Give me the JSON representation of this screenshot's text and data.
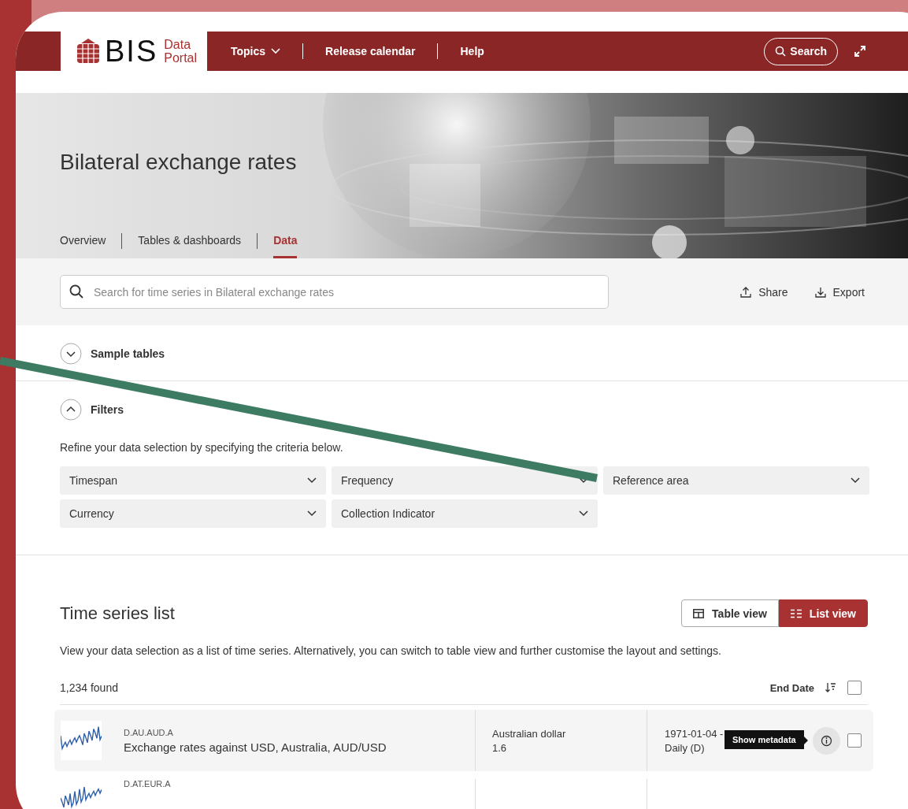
{
  "header": {
    "logo": {
      "mark": "BIS",
      "line1": "Data",
      "line2": "Portal"
    },
    "nav": [
      {
        "label": "Topics",
        "dropdown": true
      },
      {
        "label": "Release calendar",
        "dropdown": false
      },
      {
        "label": "Help",
        "dropdown": false
      }
    ],
    "search_button": "Search"
  },
  "hero": {
    "title": "Bilateral exchange rates",
    "tabs": [
      {
        "label": "Overview",
        "selected": false
      },
      {
        "label": "Tables & dashboards",
        "selected": false
      },
      {
        "label": "Data",
        "selected": true
      }
    ]
  },
  "search": {
    "placeholder": "Search for time series in Bilateral exchange rates"
  },
  "actions": [
    {
      "label": "Share",
      "kind": "share"
    },
    {
      "label": "Export",
      "kind": "export"
    }
  ],
  "sections": [
    {
      "title": "Sample tables",
      "expanded": false
    },
    {
      "title": "Filters",
      "expanded": true
    }
  ],
  "filters": {
    "hint": "Refine your data selection by specifying the criteria below.",
    "dropdowns": [
      "Timespan",
      "Frequency",
      "Reference area",
      "Currency",
      "Collection Indicator"
    ]
  },
  "time_series": {
    "title": "Time series list",
    "views": [
      {
        "label": "Table view",
        "kind": "table",
        "selected": false
      },
      {
        "label": "List view",
        "kind": "list",
        "selected": true
      }
    ],
    "description": "View your data selection as a list of time series. Alternatively, you can switch to table view and further customise the layout and settings.",
    "count": "1,234 found",
    "sort_label": "End Date",
    "select_all_checked": false,
    "rows": [
      {
        "code": "D.AU.AUD.A",
        "title": "Exchange rates against USD, Australia, AUD/USD",
        "currency": "Australian dollar",
        "value": "1.6",
        "period": "1971-01-04 -",
        "frequency": "Daily (D)",
        "checked": false,
        "tooltip": "Show metadata"
      },
      {
        "code": "D.AT.EUR.A"
      }
    ]
  }
}
